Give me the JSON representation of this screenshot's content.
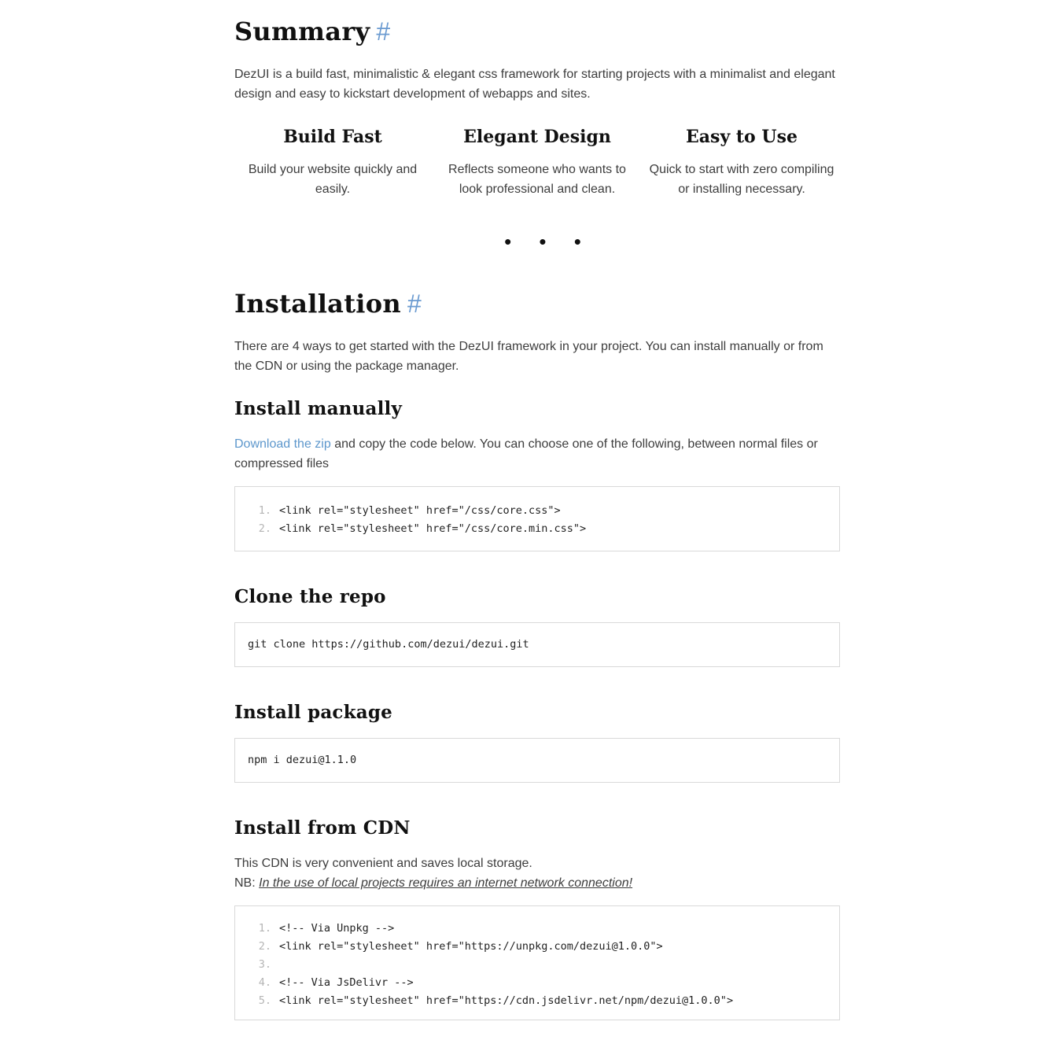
{
  "summary": {
    "title": "Summary",
    "anchor": "#",
    "description": "DezUI is a build fast, minimalistic & elegant css framework for starting projects with a minimalist and elegant design and easy to kickstart development of webapps and sites.",
    "features": [
      {
        "title": "Build Fast",
        "text": "Build your website quickly and easily."
      },
      {
        "title": "Elegant Design",
        "text": "Reflects someone who wants to look professional and clean."
      },
      {
        "title": "Easy to Use",
        "text": "Quick to start with zero compiling or installing necessary."
      }
    ],
    "separator": "• • •"
  },
  "installation": {
    "title": "Installation",
    "anchor": "#",
    "description": "There are 4 ways to get started with the DezUI framework in your project. You can install manually or from the CDN or using the package manager.",
    "manual": {
      "title": "Install manually",
      "link_text": "Download the zip",
      "text": " and copy the code below. You can choose one of the following, between normal files or compressed files",
      "code": [
        {
          "num": "1.",
          "code": "<link rel=\"stylesheet\" href=\"/css/core.css\">"
        },
        {
          "num": "2.",
          "code": "<link rel=\"stylesheet\" href=\"/css/core.min.css\">"
        }
      ]
    },
    "clone": {
      "title": "Clone the repo",
      "code": "git clone https://github.com/dezui/dezui.git"
    },
    "package": {
      "title": "Install package",
      "code": "npm i dezui@1.1.0"
    },
    "cdn": {
      "title": "Install from CDN",
      "text": "This CDN is very convenient and saves local storage.",
      "nb_label": "NB: ",
      "nb_text": "In the use of local projects requires an internet network connection!",
      "code": [
        {
          "num": "1.",
          "code": "<!-- Via Unpkg -->"
        },
        {
          "num": "2.",
          "code": "<link rel=\"stylesheet\" href=\"https://unpkg.com/dezui@1.0.0\">"
        },
        {
          "num": "3.",
          "code": ""
        },
        {
          "num": "4.",
          "code": "<!-- Via JsDelivr -->"
        },
        {
          "num": "5.",
          "code": "<link rel=\"stylesheet\" href=\"https://cdn.jsdelivr.net/npm/dezui@1.0.0\">"
        }
      ]
    }
  }
}
